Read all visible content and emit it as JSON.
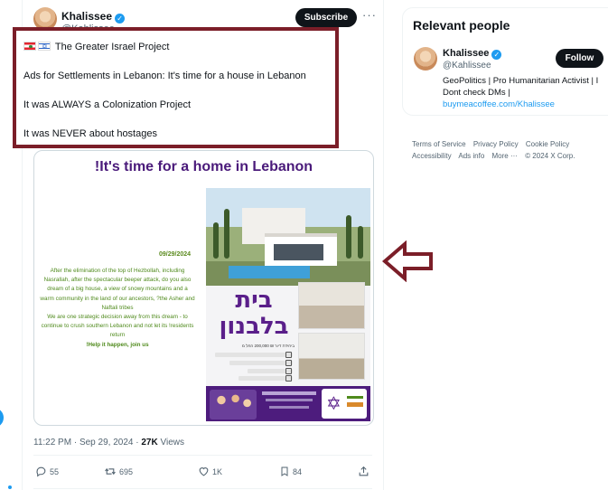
{
  "tweet": {
    "author_name": "Khalissee",
    "author_handle": "@Kahlissee",
    "subscribe_label": "Subscribe",
    "more_label": "···",
    "lines": [
      "The Greater Israel Project",
      "Ads for Settlements in Lebanon: It's time for a house in Lebanon",
      "It was ALWAYS a Colonization Project",
      "It was NEVER about hostages"
    ],
    "media": {
      "title": "!It's time for a home in Lebanon",
      "date": "09/29/2024",
      "body": [
        "After the elimination of the top of Hezbollah, including Nasrallah, after the spectacular beeper attack, do you also dream of a big house, a view of snowy mountains and a warm community in the land of our ancestors, ?the Asher and Naftali tribes",
        "We are one strategic decision away from this dream - to continue to crush southern Lebanon and not let its !residents return"
      ],
      "cta": "!Help it happen, join us",
      "hebrew_title": "בית בלבנון",
      "price_text": "ביחידת דיור ₪ 200,000 החל מ"
    },
    "timestamp": "11:22 PM · Sep 29, 2024",
    "views_count": "27K",
    "views_label": "Views",
    "actions": {
      "replies": "55",
      "reposts": "695",
      "likes": "1K",
      "bookmarks": "84"
    }
  },
  "sidebar": {
    "heading": "Relevant people",
    "person": {
      "name": "Khalissee",
      "handle": "@Kahlissee",
      "follow_label": "Follow",
      "bio": "GeoPolitics | Pro Humanitarian Activist | I Dont check DMs |",
      "link": "buymeacoffee.com/Khalissee"
    },
    "footer_links": [
      "Terms of Service",
      "Privacy Policy",
      "Cookie Policy",
      "Accessibility",
      "Ads info",
      "More ···",
      "© 2024 X Corp."
    ]
  },
  "colors": {
    "annotation_box": "#7b1e28",
    "accent": "#1d9bf0",
    "ad_purple": "#4d1c7d",
    "ad_green": "#4f8a1c"
  }
}
